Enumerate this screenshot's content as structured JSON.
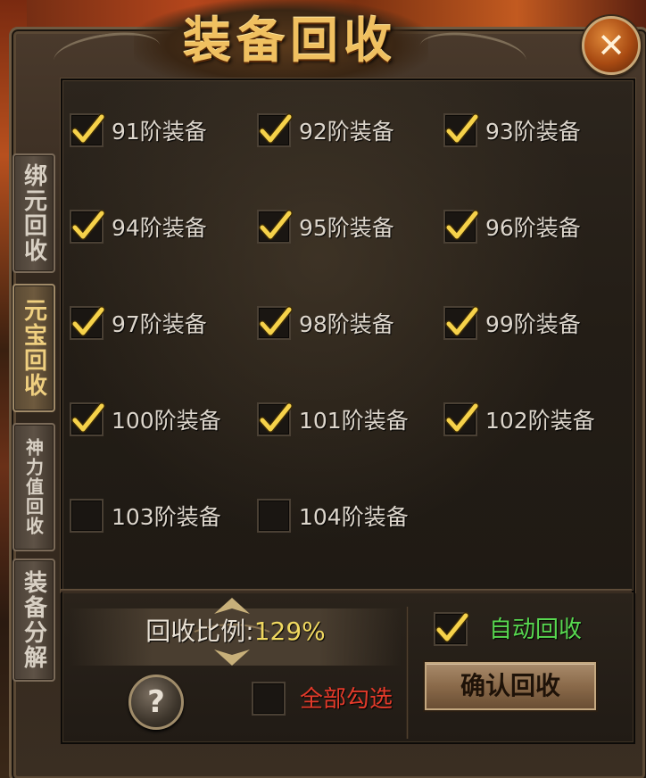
{
  "window": {
    "title": "装备回收",
    "close_icon": "close-icon"
  },
  "tabs": [
    {
      "label": "绑元回收",
      "active": false
    },
    {
      "label": "元宝回收",
      "active": true
    },
    {
      "label": "神力值回收",
      "active": false
    },
    {
      "label": "装备分解",
      "active": false
    }
  ],
  "options": [
    {
      "label": "91阶装备",
      "checked": true
    },
    {
      "label": "92阶装备",
      "checked": true
    },
    {
      "label": "93阶装备",
      "checked": true
    },
    {
      "label": "94阶装备",
      "checked": true
    },
    {
      "label": "95阶装备",
      "checked": true
    },
    {
      "label": "96阶装备",
      "checked": true
    },
    {
      "label": "97阶装备",
      "checked": true
    },
    {
      "label": "98阶装备",
      "checked": true
    },
    {
      "label": "99阶装备",
      "checked": true
    },
    {
      "label": "100阶装备",
      "checked": true
    },
    {
      "label": "101阶装备",
      "checked": true
    },
    {
      "label": "102阶装备",
      "checked": true
    },
    {
      "label": "103阶装备",
      "checked": false
    },
    {
      "label": "104阶装备",
      "checked": false
    }
  ],
  "ratio": {
    "label": "回收比例:",
    "value": "129%"
  },
  "auto_recycle": {
    "label": "自动回收",
    "checked": true
  },
  "select_all": {
    "label": "全部勾选",
    "checked": false
  },
  "confirm_button": {
    "label": "确认回收"
  },
  "help_button": {
    "label": "?"
  },
  "colors": {
    "title": "#f0c060",
    "ratio_value": "#f0d860",
    "auto_label": "#58d850",
    "select_all_label": "#e23a2a",
    "tick": "#f6d24a"
  }
}
